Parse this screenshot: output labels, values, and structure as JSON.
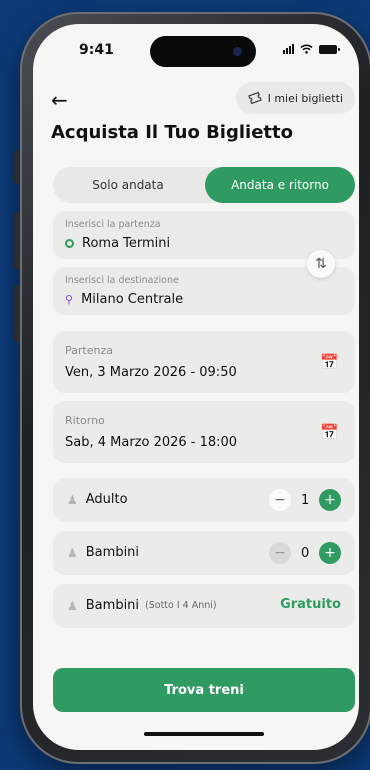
{
  "status": {
    "time": "9:41"
  },
  "header": {
    "back_icon": "arrow-left-icon",
    "my_tickets_label": "I miei biglietti",
    "title": "Acquista Il Tuo Biglietto"
  },
  "trip_type": {
    "options": [
      "Solo andata",
      "Andata e ritorno"
    ],
    "selected": "Andata e ritorno"
  },
  "route": {
    "from_label": "Inserisci la partenza",
    "from_value": "Roma Termini",
    "to_label": "Inserisci la destinazione",
    "to_value": "Milano Centrale"
  },
  "dates": {
    "departure_label": "Partenza",
    "departure_value": "Ven, 3 Marzo 2026 - 09:50",
    "return_label": "Ritorno",
    "return_value": "Sab, 4 Marzo 2026 - 18:00"
  },
  "passengers": [
    {
      "label": "Adulto",
      "count": "1"
    },
    {
      "label": "Bambini",
      "count": "0"
    },
    {
      "label": "Bambini",
      "note": "(Sotto I 4 Anni)",
      "price": "Gratuito"
    }
  ],
  "cta": {
    "label": "Trova treni"
  },
  "colors": {
    "accent": "#2f9b62",
    "background": "#0c3a78",
    "pin": "#8b45d6"
  }
}
